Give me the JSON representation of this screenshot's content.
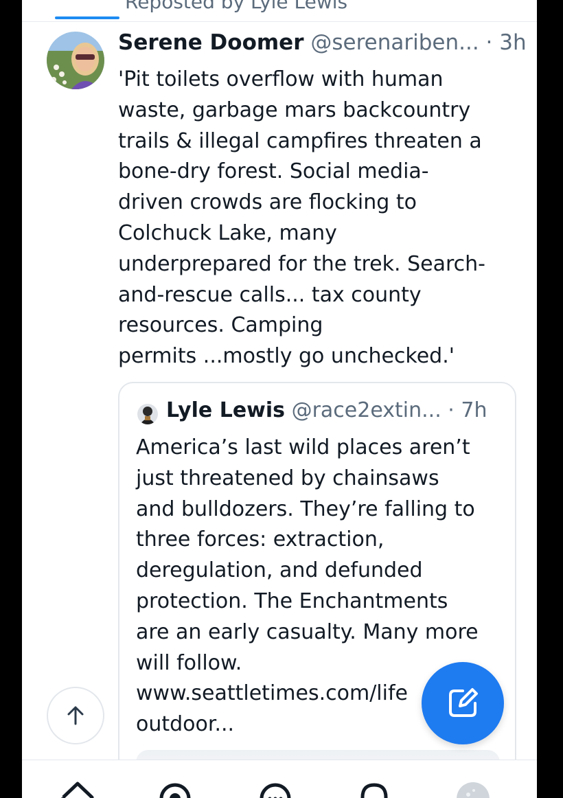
{
  "topbar": {
    "repost_text": "Reposted by Lyle Lewis"
  },
  "post": {
    "author_name": "Serene Doomer",
    "author_handle": "@serenariben...",
    "separator": " · ",
    "time": "3h",
    "text": "'Pit toilets overflow with human\nwaste, garbage mars backcountry\ntrails & illegal campfires threaten a\nbone-dry forest. Social media-\ndriven crowds are flocking to\nColchuck Lake, many\nunderprepared for the trek. Search-\nand-rescue calls... tax county\nresources. Camping\npermits ...mostly go unchecked.'"
  },
  "quote": {
    "author_name": "Lyle Lewis",
    "author_handle": "@race2extin...",
    "separator": " · ",
    "time": "7h",
    "text": "America’s last wild places aren’t\njust threatened by chainsaws\nand bulldozers. They’re falling to\nthree forces: extraction,\nderegulation, and defunded\nprotection.  The Enchantments\nare an early casualty. Many more\nwill follow.\nwww.seattletimes.com/life\noutdoor..."
  },
  "icons": {
    "avatar": "avatar-photo",
    "quote_avatar": "avatar-photo",
    "scroll_top": "arrow-up-icon",
    "compose": "compose-icon",
    "nav": [
      "home-icon",
      "search-icon",
      "chat-icon",
      "notifications-icon",
      "profile-avatar"
    ]
  },
  "colors": {
    "accent": "#1f7bf0",
    "text": "#121a24",
    "muted": "#5b6b7c",
    "border": "#e3e7ec"
  }
}
